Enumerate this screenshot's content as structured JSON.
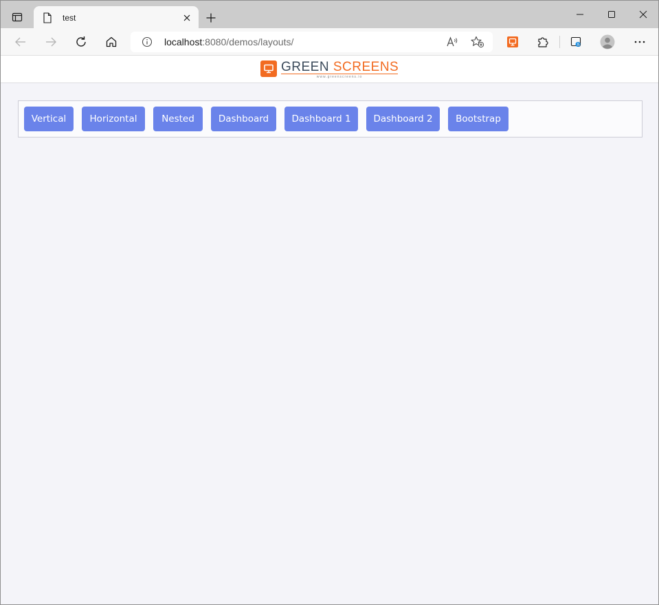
{
  "browser": {
    "tab": {
      "title": "test"
    },
    "address": {
      "host": "localhost",
      "rest": ":8080/demos/layouts/"
    }
  },
  "app": {
    "logo": {
      "word1": "GREEN",
      "word2": "SCREENS",
      "subtitle": "www.greenscreens.io"
    },
    "nav": [
      {
        "label": "Vertical"
      },
      {
        "label": "Horizontal"
      },
      {
        "label": "Nested"
      },
      {
        "label": "Dashboard"
      },
      {
        "label": "Dashboard 1"
      },
      {
        "label": "Dashboard 2"
      },
      {
        "label": "Bootstrap"
      }
    ]
  },
  "colors": {
    "accent": "#6a83ea",
    "brand_orange": "#f26b21",
    "brand_dark": "#3b4a5a",
    "page_bg": "#f4f4f9"
  }
}
